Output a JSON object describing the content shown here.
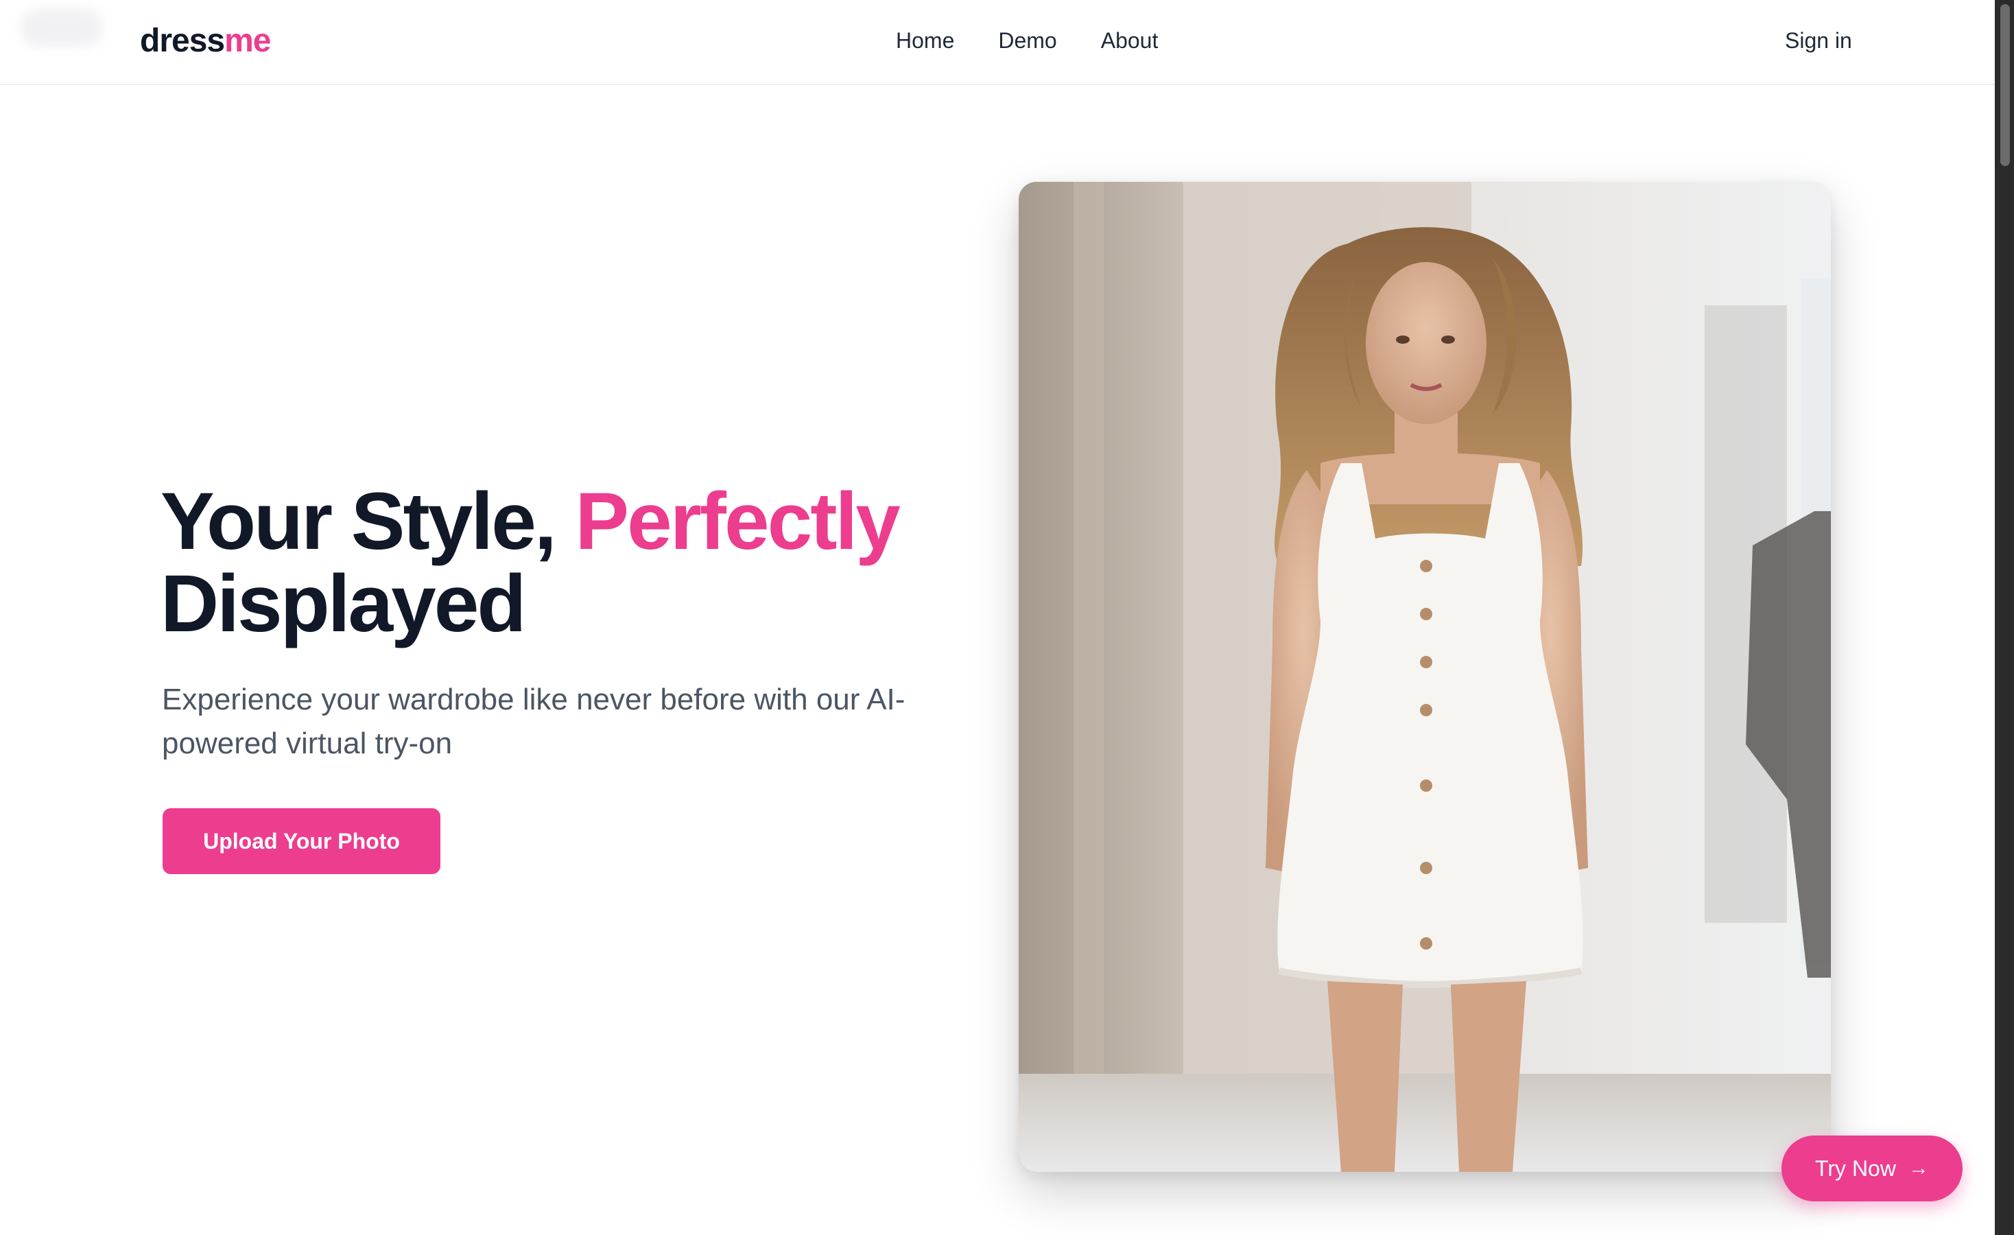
{
  "brand": {
    "part1": "dress",
    "part2": "me",
    "accent_color": "#ec3d8f"
  },
  "nav": {
    "links": [
      "Home",
      "Demo",
      "About"
    ],
    "signin": "Sign in"
  },
  "hero": {
    "title_part1": "Your Style, ",
    "title_accent": "Perfectly",
    "title_part2": "Displayed",
    "subtitle": "Experience your wardrobe like never before with our AI-powered virtual try-on",
    "cta": "Upload Your Photo",
    "image_icon": "fashion-model-photo"
  },
  "floating": {
    "label": "Try Now",
    "icon": "arrow-right-icon"
  }
}
